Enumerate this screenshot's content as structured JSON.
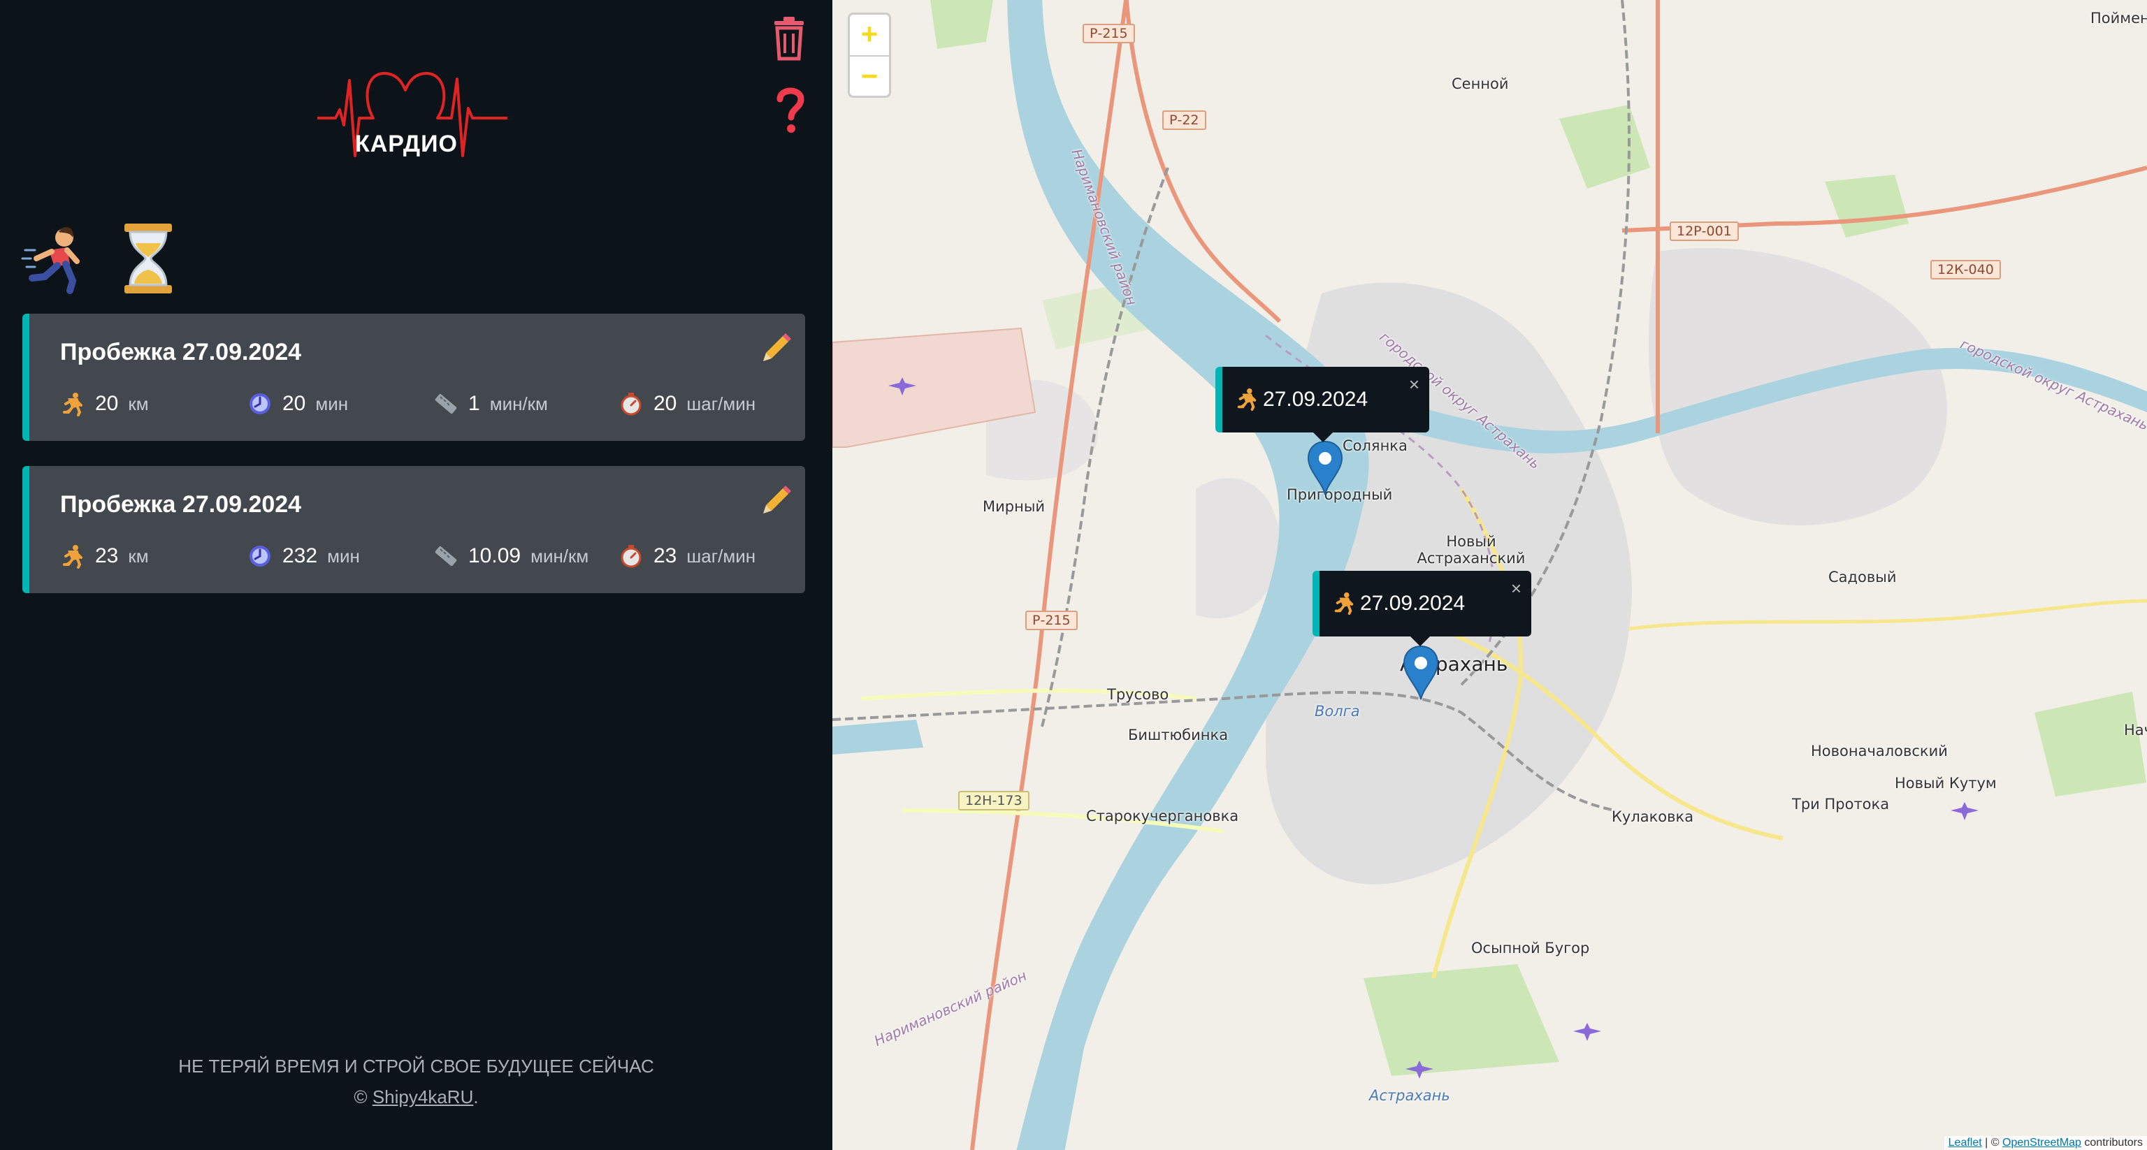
{
  "app": {
    "logo_text": "КАРДИО",
    "tools": {
      "delete_icon": "trash-icon",
      "help_icon": "question-icon"
    },
    "tabs": [
      {
        "icon": "runner-icon"
      },
      {
        "icon": "hourglass-icon"
      }
    ],
    "accent_color": "#00b5b3"
  },
  "workouts": [
    {
      "title": "Пробежка 27.09.2024",
      "distance": "20",
      "distance_unit": "км",
      "duration": "20",
      "duration_unit": "мин",
      "pace": "1",
      "pace_unit": "мин/км",
      "cadence": "20",
      "cadence_unit": "шаг/мин"
    },
    {
      "title": "Пробежка 27.09.2024",
      "distance": "23",
      "distance_unit": "км",
      "duration": "232",
      "duration_unit": "мин",
      "pace": "10.09",
      "pace_unit": "мин/км",
      "cadence": "23",
      "cadence_unit": "шаг/мин"
    }
  ],
  "footer": {
    "slogan": "НЕ ТЕРЯЙ ВРЕМЯ И СТРОЙ СВОЕ БУДУЩЕЕ СЕЙЧАС",
    "copyright": "©",
    "author_link": "Shipy4kaRU",
    "period": "."
  },
  "map": {
    "zoom_in": "+",
    "zoom_out": "−",
    "popups": [
      {
        "date": "27.09.2024",
        "close": "×"
      },
      {
        "date": "27.09.2024",
        "close": "×"
      }
    ],
    "labels": {
      "pojmenny": "Пойменны",
      "sennoy": "Сенной",
      "solyanka": "Солянка",
      "prigorodny": "Пригородный",
      "mirny": "Мирный",
      "novy_astr": "Новый Астраханский",
      "astrakhan": "Астрахань",
      "sadovy": "Садовый",
      "trusovo": "Трусово",
      "bishtyubinka": "Биштюбинка",
      "starokucherganovka": "Старокучергановка",
      "novonachalovsky": "Новоначаловский",
      "nachalovo": "Началово",
      "novy_kutum": "Новый Кутум",
      "tri_protoka": "Три Протока",
      "kulakovka": "Кулаковка",
      "osypnoy_bugor": "Осыпной Бугор",
      "volga": "Волга",
      "airport": "Астрахань",
      "narim_district_1": "Наримановский район",
      "narim_district_2": "Наримановский район",
      "gorod_okrug_1": "городской округ Астрахань",
      "gorod_okrug_2": "городской округ Астрахань"
    },
    "road_shields": {
      "r215a": "Р-215",
      "r22": "Р-22",
      "r215b": "Р-215",
      "r12p001": "12Р-001",
      "r12k040": "12К-040",
      "r12h173": "12Н-173"
    },
    "attribution": {
      "leaflet": "Leaflet",
      "sep": "| ©",
      "osm": "OpenStreetMap",
      "contributors": "contributors"
    }
  }
}
